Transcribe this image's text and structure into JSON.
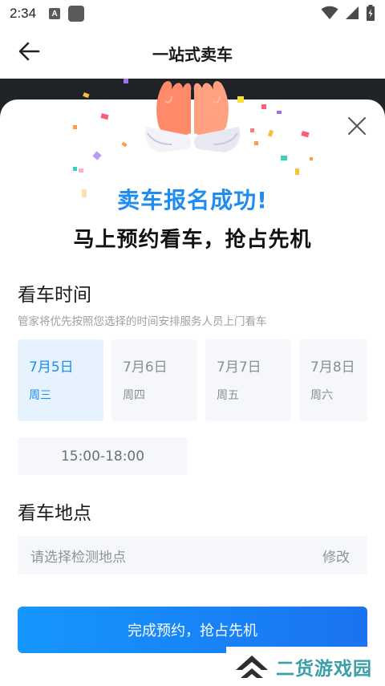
{
  "status_bar": {
    "time": "2:34",
    "app_icon_letter": "A",
    "icons": [
      "app-notification-icon",
      "square-icon",
      "wifi-icon",
      "signal-icon",
      "battery-icon"
    ]
  },
  "header": {
    "title": "一站式卖车",
    "back_icon": "arrow-left-icon"
  },
  "modal": {
    "close_icon": "close-icon",
    "illustration": "high-five-hands-icon",
    "success_title": "卖车报名成功!",
    "success_subtitle": "马上预约看车，抢占先机",
    "time_section": {
      "title": "看车时间",
      "description": "管家将优先按照您选择的时间安排服务人员上门看车",
      "dates": [
        {
          "date": "7月5日",
          "weekday": "周三",
          "selected": true
        },
        {
          "date": "7月6日",
          "weekday": "周四",
          "selected": false
        },
        {
          "date": "7月7日",
          "weekday": "周五",
          "selected": false
        },
        {
          "date": "7月8日",
          "weekday": "周六",
          "selected": false
        }
      ],
      "time_slot": "15:00-18:00"
    },
    "location_section": {
      "title": "看车地点",
      "placeholder": "请选择检测地点",
      "edit_label": "修改"
    },
    "submit_label": "完成预约，抢占先机"
  },
  "watermark": {
    "text": "二货游戏园"
  },
  "colors": {
    "accent": "#1e8cf0",
    "button_start": "#1597ff",
    "button_end": "#1a73f0",
    "selected_bg": "#e6f2fe",
    "card_bg": "#f5f7fa",
    "watermark_text": "#3aa0a8"
  }
}
